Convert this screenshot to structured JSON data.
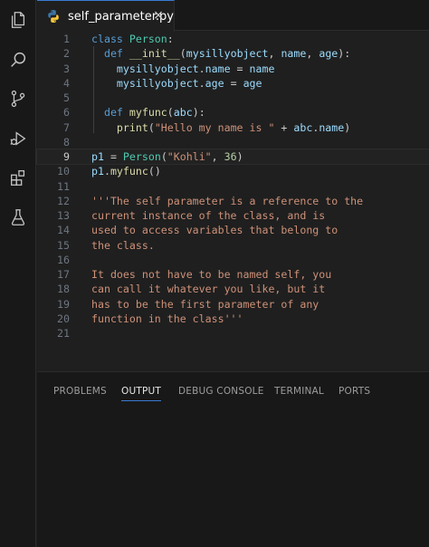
{
  "activity_bar": {
    "icons": [
      "files-icon",
      "search-icon",
      "source-control-icon",
      "run-debug-icon",
      "extensions-icon",
      "testing-icon"
    ]
  },
  "tab": {
    "file_name": "self_parameter.py",
    "close_glyph": "×"
  },
  "editor": {
    "current_line": 9,
    "lines": [
      {
        "num": "1"
      },
      {
        "num": "2"
      },
      {
        "num": "3"
      },
      {
        "num": "4"
      },
      {
        "num": "5"
      },
      {
        "num": "6"
      },
      {
        "num": "7"
      },
      {
        "num": "8"
      },
      {
        "num": "9"
      },
      {
        "num": "10"
      },
      {
        "num": "11"
      },
      {
        "num": "12"
      },
      {
        "num": "13"
      },
      {
        "num": "14"
      },
      {
        "num": "15"
      },
      {
        "num": "16"
      },
      {
        "num": "17"
      },
      {
        "num": "18"
      },
      {
        "num": "19"
      },
      {
        "num": "20"
      },
      {
        "num": "21"
      }
    ],
    "code": [
      [
        [
          "k",
          "class"
        ],
        [
          "p",
          " "
        ],
        [
          "cls",
          "Person"
        ],
        [
          "p",
          ":"
        ]
      ],
      [
        [
          "p",
          "  "
        ],
        [
          "k",
          "def"
        ],
        [
          "p",
          " "
        ],
        [
          "fn",
          "__init__"
        ],
        [
          "p",
          "("
        ],
        [
          "v",
          "mysillyobject"
        ],
        [
          "p",
          ", "
        ],
        [
          "v",
          "name"
        ],
        [
          "p",
          ", "
        ],
        [
          "v",
          "age"
        ],
        [
          "p",
          "):"
        ]
      ],
      [
        [
          "p",
          "    "
        ],
        [
          "v",
          "mysillyobject"
        ],
        [
          "p",
          "."
        ],
        [
          "v",
          "name"
        ],
        [
          "p",
          " = "
        ],
        [
          "v",
          "name"
        ]
      ],
      [
        [
          "p",
          "    "
        ],
        [
          "v",
          "mysillyobject"
        ],
        [
          "p",
          "."
        ],
        [
          "v",
          "age"
        ],
        [
          "p",
          " = "
        ],
        [
          "v",
          "age"
        ]
      ],
      [],
      [
        [
          "p",
          "  "
        ],
        [
          "k",
          "def"
        ],
        [
          "p",
          " "
        ],
        [
          "fn",
          "myfunc"
        ],
        [
          "p",
          "("
        ],
        [
          "v",
          "abc"
        ],
        [
          "p",
          "):"
        ]
      ],
      [
        [
          "p",
          "    "
        ],
        [
          "fn",
          "print"
        ],
        [
          "p",
          "("
        ],
        [
          "s",
          "\"Hello my name is \""
        ],
        [
          "p",
          " + "
        ],
        [
          "v",
          "abc"
        ],
        [
          "p",
          "."
        ],
        [
          "v",
          "name"
        ],
        [
          "p",
          ")"
        ]
      ],
      [],
      [
        [
          "v",
          "p1"
        ],
        [
          "p",
          " = "
        ],
        [
          "cls",
          "Person"
        ],
        [
          "p",
          "("
        ],
        [
          "s",
          "\"Kohli\""
        ],
        [
          "p",
          ", "
        ],
        [
          "n",
          "36"
        ],
        [
          "p",
          ")"
        ]
      ],
      [
        [
          "v",
          "p1"
        ],
        [
          "p",
          "."
        ],
        [
          "fn",
          "myfunc"
        ],
        [
          "p",
          "()"
        ]
      ],
      [],
      [
        [
          "s",
          "'''The self parameter is a reference to the"
        ]
      ],
      [
        [
          "s",
          "current instance of the class, and is"
        ]
      ],
      [
        [
          "s",
          "used to access variables that belong to"
        ]
      ],
      [
        [
          "s",
          "the class."
        ]
      ],
      [],
      [
        [
          "s",
          "It does not have to be named self, you"
        ]
      ],
      [
        [
          "s",
          "can call it whatever you like, but it"
        ]
      ],
      [
        [
          "s",
          "has to be the first parameter of any"
        ]
      ],
      [
        [
          "s",
          "function in the class'''"
        ]
      ],
      []
    ]
  },
  "panel": {
    "tabs": [
      {
        "label": "PROBLEMS",
        "active": false
      },
      {
        "label": "OUTPUT",
        "active": true
      },
      {
        "label": "DEBUG CONSOLE",
        "active": false
      },
      {
        "label": "TERMINAL",
        "active": false
      },
      {
        "label": "PORTS",
        "active": false
      }
    ]
  },
  "colors": {
    "editor_bg": "#1f1f1f",
    "keyword": "#569cd6",
    "class_name": "#4ec9b0",
    "function": "#dcdcaa",
    "string": "#ce9178",
    "number": "#b5cea8",
    "variable": "#9cdcfe",
    "accent": "#3a7bd5"
  }
}
